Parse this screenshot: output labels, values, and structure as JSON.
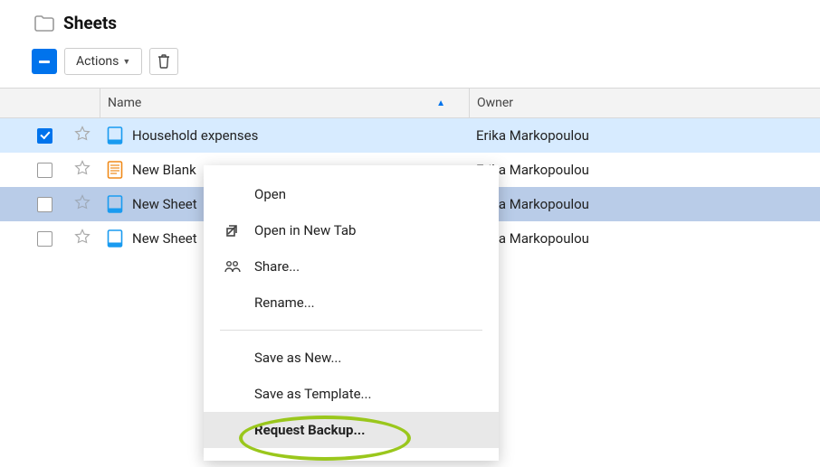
{
  "header": {
    "title": "Sheets"
  },
  "toolbar": {
    "actions_label": "Actions"
  },
  "columns": {
    "name": "Name",
    "owner": "Owner"
  },
  "rows": [
    {
      "name": "Household expenses",
      "owner": "Erika Markopoulou",
      "checked": true,
      "selected": true,
      "icon": "sheet-blue"
    },
    {
      "name": "New Blank",
      "owner": "Erika Markopoulou",
      "checked": false,
      "selected": false,
      "icon": "sheet-orange"
    },
    {
      "name": "New Sheet",
      "owner": "Erika Markopoulou",
      "checked": false,
      "selected": false,
      "icon": "sheet-blue",
      "hover": true
    },
    {
      "name": "New Sheet",
      "owner": "Erika Markopoulou",
      "checked": false,
      "selected": false,
      "icon": "sheet-blue"
    }
  ],
  "context_menu": {
    "open": "Open",
    "open_new_tab": "Open in New Tab",
    "share": "Share...",
    "rename": "Rename...",
    "save_as_new": "Save as New...",
    "save_as_template": "Save as Template...",
    "request_backup": "Request Backup..."
  },
  "colors": {
    "accent": "#0073ec",
    "annotation": "#9ac71c"
  }
}
